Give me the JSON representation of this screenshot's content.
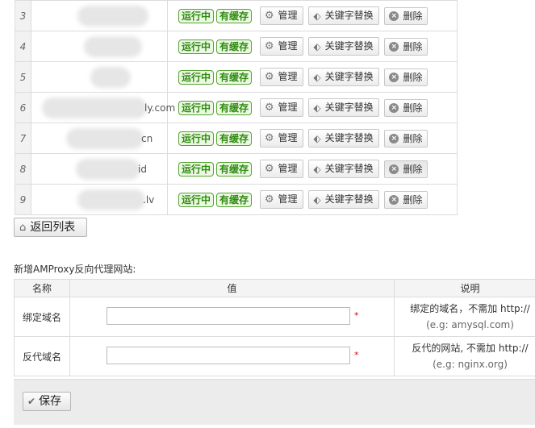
{
  "sites": [
    {
      "index": "3",
      "domain_suffix": ""
    },
    {
      "index": "4",
      "domain_suffix": ""
    },
    {
      "index": "5",
      "domain_suffix": ""
    },
    {
      "index": "6",
      "domain_suffix": "ly.com"
    },
    {
      "index": "7",
      "domain_suffix": "cn"
    },
    {
      "index": "8",
      "domain_suffix": "id"
    },
    {
      "index": "9",
      "domain_suffix": ".lv"
    }
  ],
  "row_labels": {
    "running": "运行中",
    "cached": "有缓存",
    "manage": "管理",
    "keyword_replace": "关键字替换",
    "delete": "删除"
  },
  "back_button": "返回列表",
  "form": {
    "title": "新增AMProxy反向代理网站:",
    "headers": {
      "name": "名称",
      "value": "值",
      "desc": "说明"
    },
    "rows": [
      {
        "label": "绑定域名",
        "required": "*",
        "desc": "绑定的域名，不需加 http://",
        "example": "(e.g: amysql.com)"
      },
      {
        "label": "反代域名",
        "required": "*",
        "desc": "反代的网站, 不需加 http://",
        "example": "(e.g: nginx.org)"
      }
    ],
    "save": "保存"
  },
  "colors": {
    "badge_green": "#2e8b0f",
    "badge_border": "#54a331",
    "required": "#dd0000"
  }
}
